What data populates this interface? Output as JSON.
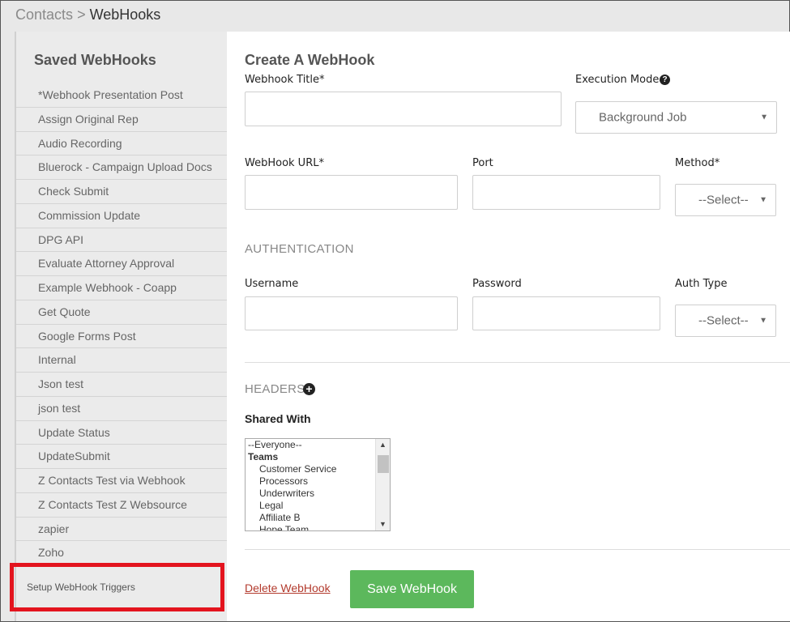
{
  "breadcrumb": {
    "parent": "Contacts",
    "separator": ">",
    "current": "WebHooks"
  },
  "sidebar": {
    "title": "Saved WebHooks",
    "items": [
      "*Webhook Presentation Post",
      "Assign Original Rep",
      "Audio Recording",
      "Bluerock - Campaign Upload Docs",
      "Check Submit",
      "Commission Update",
      "DPG API",
      "Evaluate Attorney Approval",
      "Example Webhook - Coapp",
      "Get Quote",
      "Google Forms Post",
      "Internal",
      "Json test",
      "json test",
      "Update Status",
      "UpdateSubmit",
      "Z Contacts Test via Webhook",
      "Z Contacts Test Z Websource",
      "zapier",
      "Zoho"
    ],
    "setup_triggers": "Setup WebHook Triggers"
  },
  "form": {
    "title": "Create A WebHook",
    "webhook_title_label": "Webhook Title*",
    "webhook_title_value": "",
    "execution_mode_label": "Execution Mode",
    "execution_mode_value": "Background Job",
    "help_icon_glyph": "?",
    "url_label": "WebHook URL*",
    "url_value": "",
    "port_label": "Port",
    "port_value": "",
    "method_label": "Method*",
    "method_value": "--Select--",
    "auth_heading": "AUTHENTICATION",
    "username_label": "Username",
    "username_value": "",
    "password_label": "Password",
    "password_value": "",
    "auth_type_label": "Auth Type",
    "auth_type_value": "--Select--",
    "headers_heading": "HEADERS",
    "plus_icon_glyph": "+",
    "shared_with_label": "Shared With",
    "shared_options": [
      {
        "label": "--Everyone--",
        "kind": "opt"
      },
      {
        "label": "Teams",
        "kind": "grp"
      },
      {
        "label": "Customer Service",
        "kind": "sub"
      },
      {
        "label": "Processors",
        "kind": "sub"
      },
      {
        "label": "Underwriters",
        "kind": "sub"
      },
      {
        "label": "Legal",
        "kind": "sub"
      },
      {
        "label": "Affiliate B",
        "kind": "sub"
      },
      {
        "label": "Hope Team",
        "kind": "sub"
      }
    ],
    "delete_label": "Delete WebHook",
    "save_label": "Save WebHook"
  },
  "colors": {
    "save_button": "#5cb85c",
    "delete_link": "#b33b2e",
    "highlight_box": "#e3141e"
  },
  "icons": {
    "help": "question-circle-icon",
    "add_header": "plus-circle-icon",
    "dropdown": "caret-down-icon"
  }
}
